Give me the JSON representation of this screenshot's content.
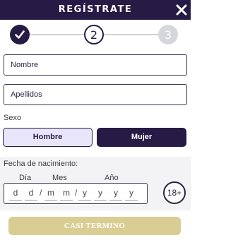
{
  "header": {
    "title": "REGÍSTRATE",
    "close_icon": "close-icon",
    "background_color": "#261b45"
  },
  "stepper": {
    "current_step": 2,
    "steps": [
      {
        "label": "",
        "state": "completed",
        "icon": "check-icon"
      },
      {
        "label": "2",
        "state": "active"
      },
      {
        "label": "3",
        "state": "inactive"
      }
    ]
  },
  "form": {
    "nombre_placeholder": "Nombre",
    "apellidos_placeholder": "Apellidos",
    "sexo_label": "Sexo",
    "sexo_options": [
      {
        "label": "Hombre",
        "selected": false
      },
      {
        "label": "Mujer",
        "selected": true
      }
    ],
    "dob": {
      "label": "Fecha de nacimiento:",
      "columns": {
        "day": "Día",
        "month": "Mes",
        "year": "Año"
      },
      "day_chars": [
        "d",
        "d"
      ],
      "month_chars": [
        "m",
        "m"
      ],
      "year_chars": [
        "y",
        "y",
        "y",
        "y"
      ],
      "separator": "/"
    },
    "age_badge": "18+",
    "submit_label": "CASI TERMINO"
  },
  "colors": {
    "primary": "#261b45",
    "selected_option_bg": "#e9e5fb",
    "submit_disabled": "#d9cd93",
    "inactive_step": "#d6d7dc"
  }
}
